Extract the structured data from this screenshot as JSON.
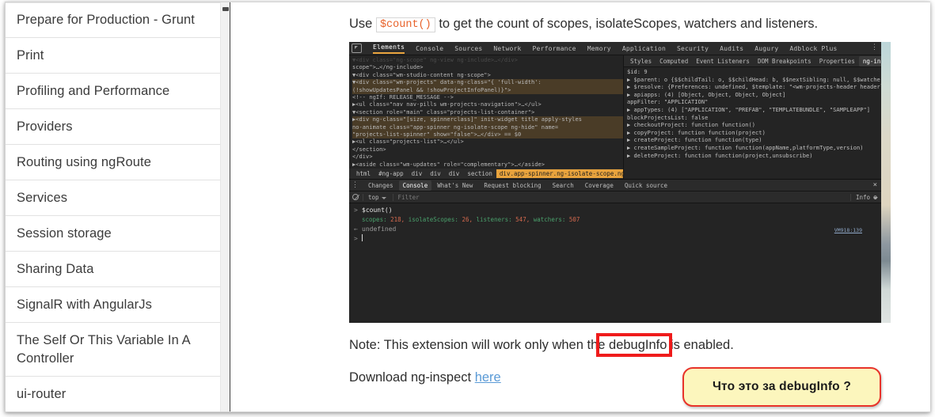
{
  "sidebar": {
    "items": [
      {
        "label": "Prepare for Production - Grunt",
        "tall": false
      },
      {
        "label": "Print",
        "tall": false
      },
      {
        "label": "Profiling and Performance",
        "tall": false
      },
      {
        "label": "Providers",
        "tall": false
      },
      {
        "label": "Routing using ngRoute",
        "tall": false
      },
      {
        "label": "Services",
        "tall": false
      },
      {
        "label": "Session storage",
        "tall": false
      },
      {
        "label": "Sharing Data",
        "tall": false
      },
      {
        "label": "SignalR with AngularJs",
        "tall": false
      },
      {
        "label": "The Self Or This Variable In A Controller",
        "tall": true
      },
      {
        "label": "ui-router",
        "tall": false
      }
    ]
  },
  "content": {
    "lead_before": "Use ",
    "lead_code": "$count()",
    "lead_after": " to get the count of scopes, isolateScopes, watchers and listeners.",
    "note_text": "Note: This extension will work only when the debugInfo is enabled.",
    "note_highlighted": "debugInfo is",
    "download_text": "Download ng-inspect ",
    "download_link": "here"
  },
  "callout": {
    "text": "Что это за debugInfo ?",
    "fill": "#fcf6bd",
    "border": "#e8332a"
  },
  "devtools": {
    "inspect_icon": "inspect-element-icon",
    "tabs": [
      "Elements",
      "Console",
      "Sources",
      "Network",
      "Performance",
      "Memory",
      "Application",
      "Security",
      "Audits",
      "Augury",
      "Adblock Plus"
    ],
    "active_tab": "Elements",
    "kebab": "⋮",
    "dom_lines": [
      {
        "text": "▼<div class=\"ng-scope\" ng-view ng-include>…</div>",
        "faded": true,
        "hl": false
      },
      {
        "text": "scope\">…</ng-include>",
        "faded": false,
        "hl": false
      },
      {
        "text": "▼<div class=\"wm-studio-content ng-scope\">",
        "faded": false,
        "hl": false
      },
      {
        "text": "▼<div class=\"wm-projects\" data-ng-class=\"{ 'full-width':",
        "faded": false,
        "hl": true
      },
      {
        "text": "(!showUpdatesPanel && !showProjectInfoPanel)}\">",
        "faded": false,
        "hl": true
      },
      {
        "text": "<!-- ngIf: RELEASE_MESSAGE -->",
        "faded": false,
        "hl": false
      },
      {
        "text": "▶<ul class=\"nav nav-pills wm-projects-navigation\">…</ul>",
        "faded": false,
        "hl": false
      },
      {
        "text": "▼<section role=\"main\" class=\"projects-list-container\">",
        "faded": false,
        "hl": false
      },
      {
        "text": "▶<div ng-class=\"[size, spinnerclass]\" init-widget title apply-styles",
        "faded": false,
        "hl": true
      },
      {
        "text": "no-animate class=\"app-spinner ng-isolate-scope ng-hide\" name=",
        "faded": false,
        "hl": true
      },
      {
        "text": "\"projects-list-spinner\" show=\"false\">…</div>  == $0",
        "faded": false,
        "hl": true
      },
      {
        "text": "▶<ul class=\"projects-list\">…</ul>",
        "faded": false,
        "hl": false
      },
      {
        "text": "</section>",
        "faded": false,
        "hl": false
      },
      {
        "text": "</div>",
        "faded": false,
        "hl": false
      },
      {
        "text": "▶<aside class=\"wm-updates\" role=\"complementary\">…</aside>",
        "faded": false,
        "hl": false
      }
    ],
    "breadcrumbs": [
      "html",
      "#ng-app",
      "div",
      "div",
      "div",
      "section"
    ],
    "breadcrumb_selected": "div.app-spinner.ng-isolate-scope.ng-hide",
    "sidebar_tabs": [
      "Styles",
      "Computed",
      "Event Listeners",
      "DOM Breakpoints",
      "Properties",
      "ng-inspect"
    ],
    "sidebar_active_tab": "ng-inspect",
    "properties": [
      "$id: 9",
      "▶ $parent: o {$$childTail: o, $$childHead: b, $$nextSibling: null, $$watchers:",
      "▶ $resolve: {Preferences: undefined, $template: \"<wm-projects-header headerlabe",
      "▶ apiapps: (4) [Object, Object, Object, Object]",
      "appFilter: \"APPLICATION\"",
      "▶ appTypes: (4) [\"APPLICATION\", \"PREFAB\", \"TEMPLATEBUNDLE\", \"SAMPLEAPP\"]",
      "blockProjectsList: false",
      "▶ checkoutProject: function function()",
      "▶ copyProject: function function(project)",
      "▶ createProject: function function(type)",
      "▶ createSampleProject: function function(appName,platformType,version)",
      "▶ deleteProject: function function(project,unsubscribe)"
    ],
    "console": {
      "tabs": [
        "Changes",
        "Console",
        "What's New",
        "Request blocking",
        "Search",
        "Coverage",
        "Quick source"
      ],
      "active_tab": "Console",
      "close_label": "×",
      "clear_icon": "clear-console-icon",
      "context": "top",
      "filter_placeholder": "Filter",
      "level": "Info",
      "gear_icon": "settings-gear-icon",
      "prompt": "$count()",
      "output_keys": [
        "scopes:",
        "isolateScopes:",
        "listeners:",
        "watchers:"
      ],
      "output_values": [
        "218",
        "26",
        "547",
        "507"
      ],
      "undefined_label": "undefined",
      "source_link": "VM918:139"
    }
  }
}
